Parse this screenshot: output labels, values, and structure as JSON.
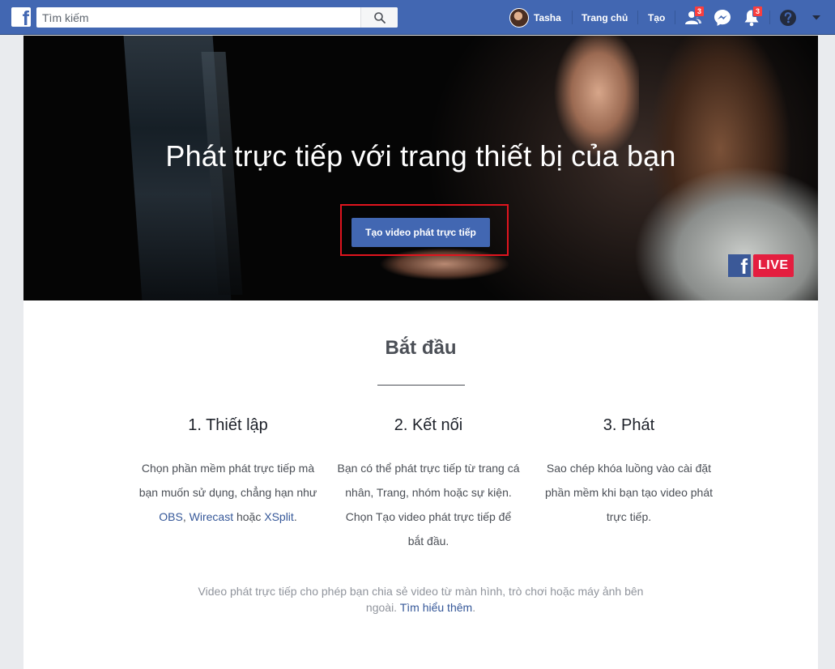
{
  "topbar": {
    "search_placeholder": "Tìm kiếm",
    "user_name": "Tasha",
    "home_label": "Trang chủ",
    "create_label": "Tạo",
    "friend_requests_count": "3",
    "notifications_count": "3"
  },
  "hero": {
    "title": "Phát trực tiếp với trang thiết bị của bạn",
    "cta_label": "Tạo video phát trực tiếp",
    "live_badge": "LIVE",
    "live_logo_f": "f"
  },
  "getting_started": {
    "title": "Bắt đầu",
    "steps": [
      {
        "title": "1. Thiết lập",
        "text_before": "Chọn phần mềm phát trực tiếp mà bạn muốn sử dụng, chẳng hạn như ",
        "link1": "OBS",
        "comma": ", ",
        "link2": "Wirecast",
        "middle": " hoặc ",
        "link3": "XSplit",
        "end": "."
      },
      {
        "title": "2. Kết nối",
        "text": "Bạn có thể phát trực tiếp từ trang cá nhân, Trang, nhóm hoặc sự kiện. Chọn Tạo video phát trực tiếp để bắt đầu."
      },
      {
        "title": "3. Phát",
        "text": "Sao chép khóa luồng vào cài đặt phần mềm khi bạn tạo video phát trực tiếp."
      }
    ],
    "footer_text": "Video phát trực tiếp cho phép bạn chia sẻ video từ màn hình, trò chơi hoặc máy ảnh bên ngoài. ",
    "footer_link": "Tìm hiểu thêm",
    "footer_end": "."
  },
  "colors": {
    "brand_blue": "#4267b2",
    "badge_red": "#fa3e3e",
    "highlight_red": "#e0141e",
    "live_red": "#e41e3f"
  },
  "icons": [
    "facebook-logo-icon",
    "search-icon",
    "friends-icon",
    "messenger-icon",
    "notifications-icon",
    "help-icon",
    "caret-down-icon"
  ]
}
